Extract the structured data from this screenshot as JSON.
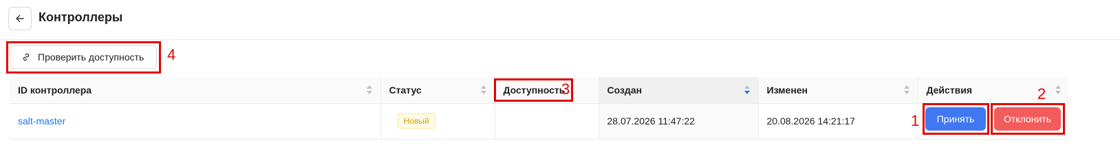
{
  "header": {
    "title": "Контроллеры",
    "back_icon": "arrow-left-icon"
  },
  "toolbar": {
    "check_label": "Проверить доступность",
    "check_icon": "link-icon"
  },
  "table": {
    "columns": [
      {
        "label": "ID контроллера",
        "sortable": true
      },
      {
        "label": "Статус",
        "sortable": true
      },
      {
        "label": "Доступность",
        "sortable": false
      },
      {
        "label": "Создан",
        "sortable": true,
        "sort": "descending"
      },
      {
        "label": "Изменен",
        "sortable": true
      },
      {
        "label": "Действия",
        "sortable": true
      }
    ],
    "rows": [
      {
        "id": "salt-master",
        "status": "Новый",
        "availability": "",
        "created": "28.07.2026 11:47:22",
        "modified": "20.08.2026 14:21:17",
        "actions": {
          "accept": "Принять",
          "reject": "Отклонить"
        }
      }
    ]
  },
  "annotations": [
    "1",
    "2",
    "3",
    "4"
  ],
  "colors": {
    "primary": "#3f78f2",
    "danger": "#f25c5c",
    "link": "#1677ff",
    "annotation": "#e60000"
  }
}
